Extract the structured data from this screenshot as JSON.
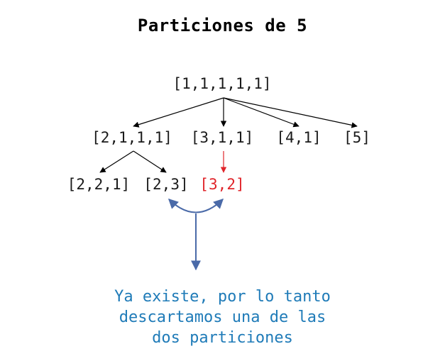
{
  "title": "Particiones de 5",
  "nodes": {
    "root": "[1,1,1,1,1]",
    "l1_a": "[2,1,1,1]",
    "l1_b": "[3,1,1]",
    "l1_c": "[4,1]",
    "l1_d": "[5]",
    "l2_a": "[2,2,1]",
    "l2_b": "[2,3]",
    "l2_c": "[3,2]"
  },
  "note": {
    "line1": "Ya existe, por lo tanto",
    "line2": "descartamos una de las",
    "line3": "dos particiones"
  },
  "colors": {
    "edge": "#000000",
    "duplicate": "#e0242a",
    "annotation": "#4a6aa8",
    "note_text": "#1f7bb8"
  }
}
